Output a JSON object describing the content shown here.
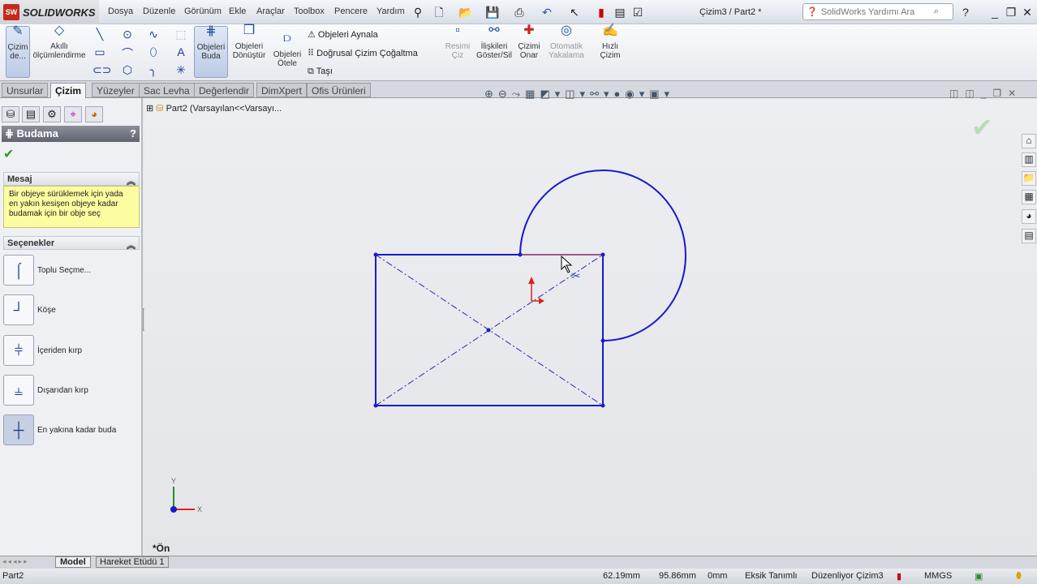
{
  "app": {
    "name": "SOLIDWORKS",
    "logo": "SW",
    "document_title": "Çizim3 / Part2 *"
  },
  "menu": [
    "Dosya",
    "Düzenle",
    "Görünüm",
    "Ekle",
    "Araçlar",
    "Toolbox",
    "Pencere",
    "Yardım"
  ],
  "search": {
    "placeholder": "SolidWorks Yardımı Ara"
  },
  "commands": {
    "sketch": "Çizim de...",
    "smart_dim": "Akıllı ölçümlendirme",
    "trim": "Objeleri Buda",
    "convert": "Objeleri Dönüştür",
    "offset": "Objeleri Ötele",
    "mirror": "Objeleri Aynala",
    "linear_pattern": "Doğrusal Çizim Çoğaltma",
    "move": "Taşı",
    "sketch_picture": "Resimi Çiz",
    "relations": "İlişkileri Göster/Sil",
    "repair": "Çizimi Onar",
    "quick_snaps": "Otomatik Yakalama",
    "rapid_sketch": "Hızlı Çizim"
  },
  "tabs": [
    "Unsurlar",
    "Çizim",
    "Yüzeyler",
    "Sac Levha",
    "Değerlendir",
    "DimXpert",
    "Ofis Ürünleri"
  ],
  "active_tab": "Çizim",
  "tree": {
    "part": "Part2  (Varsayılan<<Varsayı..."
  },
  "property_manager": {
    "title": "Budama",
    "help": "?",
    "message_header": "Mesaj",
    "message": "Bir objeye sürüklemek için yada en yakın kesişen objeye kadar budamak için bir obje seç",
    "options_header": "Seçenekler",
    "options": [
      "Toplu Seçme...",
      "Köşe",
      "İçeriden kırp",
      "Dışarıdan kırp",
      "En yakına kadar buda"
    ],
    "selected_option": 4
  },
  "view": {
    "orientation": "*Ön",
    "axis_x": "X",
    "axis_y": "Y"
  },
  "bottom_tabs": [
    "Model",
    "Hareket Etüdü 1"
  ],
  "status": {
    "doc": "Part2",
    "x": "62.19mm",
    "y": "95.86mm",
    "z": "0mm",
    "state": "Eksik Tanımlı",
    "editing": "Düzenliyor Çizim3",
    "units": "MMGS"
  },
  "colors": {
    "sketch": "#1a1acc",
    "accent": "#1c4fa0"
  }
}
